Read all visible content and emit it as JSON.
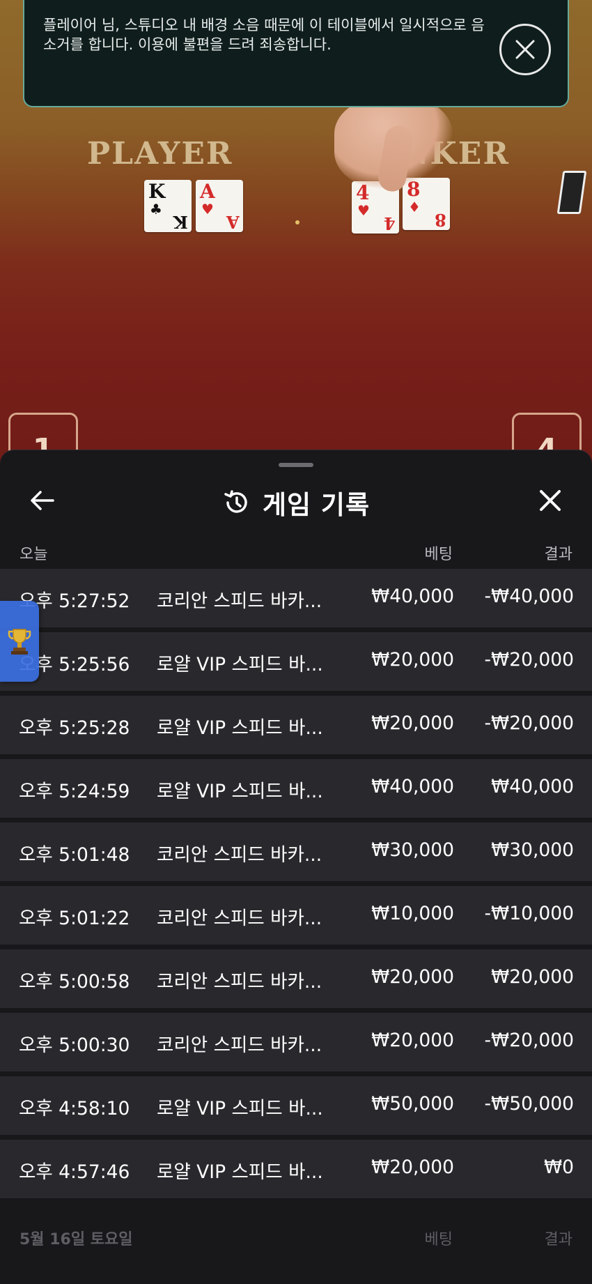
{
  "live_table": {
    "player_label": "PLAYER",
    "banker_label": "BANKER",
    "player_cards": [
      {
        "rank": "K",
        "suit": "♣",
        "color": "#111111"
      },
      {
        "rank": "A",
        "suit": "♥",
        "color": "#d42a2a"
      }
    ],
    "banker_cards": [
      {
        "rank": "4",
        "suit": "♥",
        "color": "#d42a2a"
      },
      {
        "rank": "8",
        "suit": "♦",
        "color": "#d42a2a"
      }
    ],
    "seat_left": "1",
    "seat_right": "4"
  },
  "notice": {
    "text": "플레이어 님, 스튜디오 내 배경 소음 때문에 이 테이블에서 일시적으로 음소거를 합니다. 이용에 불편을 드려 죄송합니다.",
    "close_icon": "close-circle-icon"
  },
  "history": {
    "title": "게임 기록",
    "title_icon": "history-icon",
    "back_icon": "arrow-left-icon",
    "close_icon": "close-icon",
    "sections": [
      {
        "label": "오늘",
        "bet_header": "베팅",
        "result_header": "결과"
      },
      {
        "label": "5월 16일 토요일",
        "bet_header": "베팅",
        "result_header": "결과"
      }
    ],
    "rows": [
      {
        "time": "오후 5:27:52",
        "game": "코리안 스피드 바카...",
        "bet": "₩40,000",
        "result": "-₩40,000"
      },
      {
        "time": "오후 5:25:56",
        "game": "로얄 VIP 스피드 바...",
        "bet": "₩20,000",
        "result": "-₩20,000"
      },
      {
        "time": "오후 5:25:28",
        "game": "로얄 VIP 스피드 바...",
        "bet": "₩20,000",
        "result": "-₩20,000"
      },
      {
        "time": "오후 5:24:59",
        "game": "로얄 VIP 스피드 바...",
        "bet": "₩40,000",
        "result": "₩40,000"
      },
      {
        "time": "오후 5:01:48",
        "game": "코리안 스피드 바카...",
        "bet": "₩30,000",
        "result": "₩30,000"
      },
      {
        "time": "오후 5:01:22",
        "game": "코리안 스피드 바카...",
        "bet": "₩10,000",
        "result": "-₩10,000"
      },
      {
        "time": "오후 5:00:58",
        "game": "코리안 스피드 바카...",
        "bet": "₩20,000",
        "result": "₩20,000"
      },
      {
        "time": "오후 5:00:30",
        "game": "코리안 스피드 바카...",
        "bet": "₩20,000",
        "result": "-₩20,000"
      },
      {
        "time": "오후 4:58:10",
        "game": "로얄 VIP 스피드 바...",
        "bet": "₩50,000",
        "result": "-₩50,000"
      },
      {
        "time": "오후 4:57:46",
        "game": "로얄 VIP 스피드 바...",
        "bet": "₩20,000",
        "result": "₩0"
      }
    ]
  },
  "trophy_tab": {
    "icon": "trophy-icon"
  }
}
